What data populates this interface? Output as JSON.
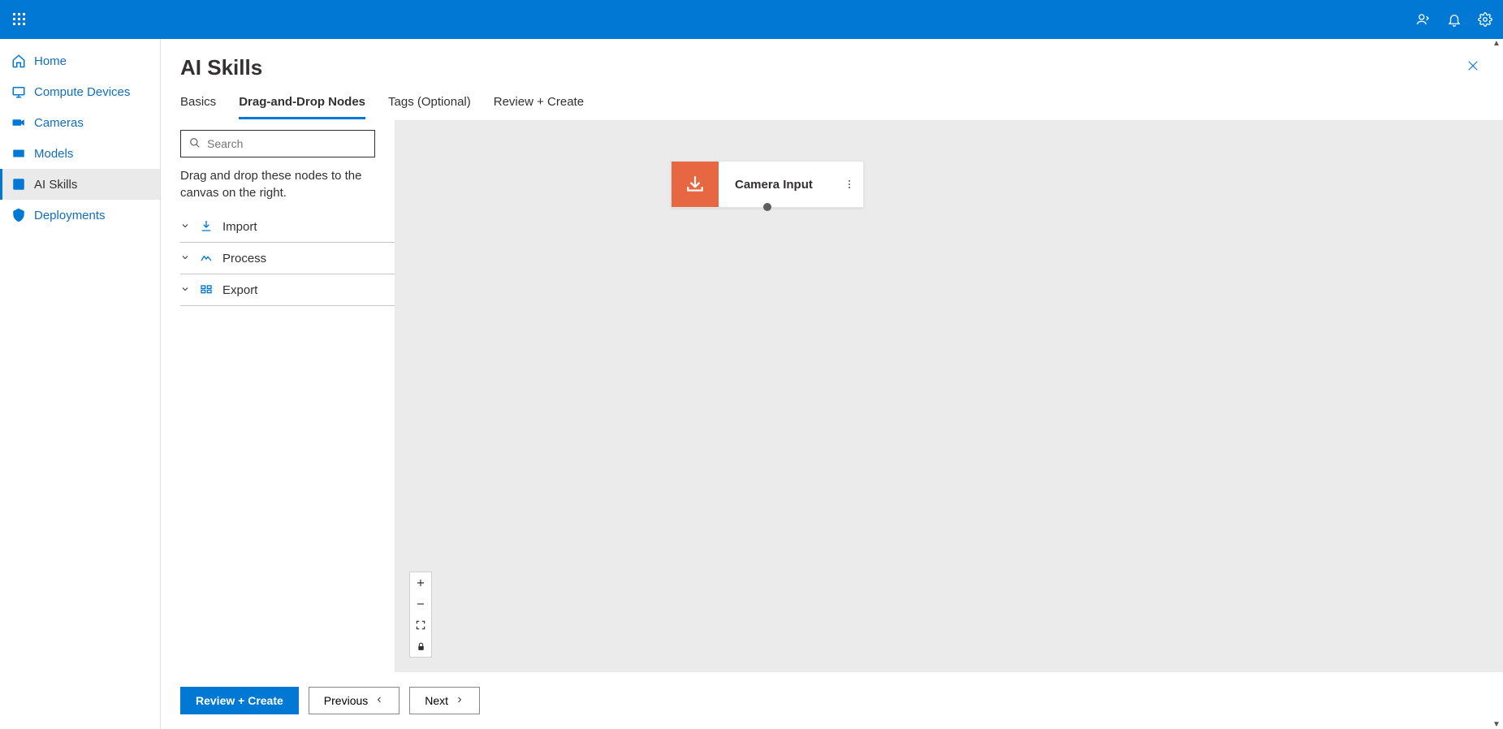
{
  "topbar": {
    "waffle_icon": "app-launcher-icon",
    "right_icons": {
      "feedback": "feedback-icon",
      "notifications": "bell-icon",
      "settings": "gear-icon"
    }
  },
  "sidenav": {
    "items": [
      {
        "icon": "home-icon",
        "label": "Home"
      },
      {
        "icon": "compute-icon",
        "label": "Compute Devices"
      },
      {
        "icon": "camera-icon",
        "label": "Cameras"
      },
      {
        "icon": "model-icon",
        "label": "Models"
      },
      {
        "icon": "ai-skill-icon",
        "label": "AI Skills"
      },
      {
        "icon": "deployment-icon",
        "label": "Deployments"
      }
    ],
    "active_index": 4
  },
  "page": {
    "title": "AI Skills"
  },
  "tabs": {
    "items": [
      {
        "label": "Basics"
      },
      {
        "label": "Drag-and-Drop Nodes"
      },
      {
        "label": "Tags (Optional)"
      },
      {
        "label": "Review + Create"
      }
    ],
    "active_index": 1
  },
  "palette": {
    "search_placeholder": "Search",
    "help_text": "Drag and drop these nodes to the canvas on the right.",
    "groups": [
      {
        "icon": "import-icon",
        "label": "Import"
      },
      {
        "icon": "process-icon",
        "label": "Process"
      },
      {
        "icon": "export-icon",
        "label": "Export"
      }
    ]
  },
  "canvas": {
    "node": {
      "label": "Camera Input",
      "icon": "download-input-icon",
      "icon_bg": "#e86743"
    },
    "zoom_controls": {
      "zoom_in": "plus-icon",
      "zoom_out": "minus-icon",
      "fit": "fullscreen-icon",
      "lock": "lock-icon"
    }
  },
  "footer": {
    "review_create_label": "Review + Create",
    "previous_label": "Previous",
    "next_label": "Next"
  }
}
